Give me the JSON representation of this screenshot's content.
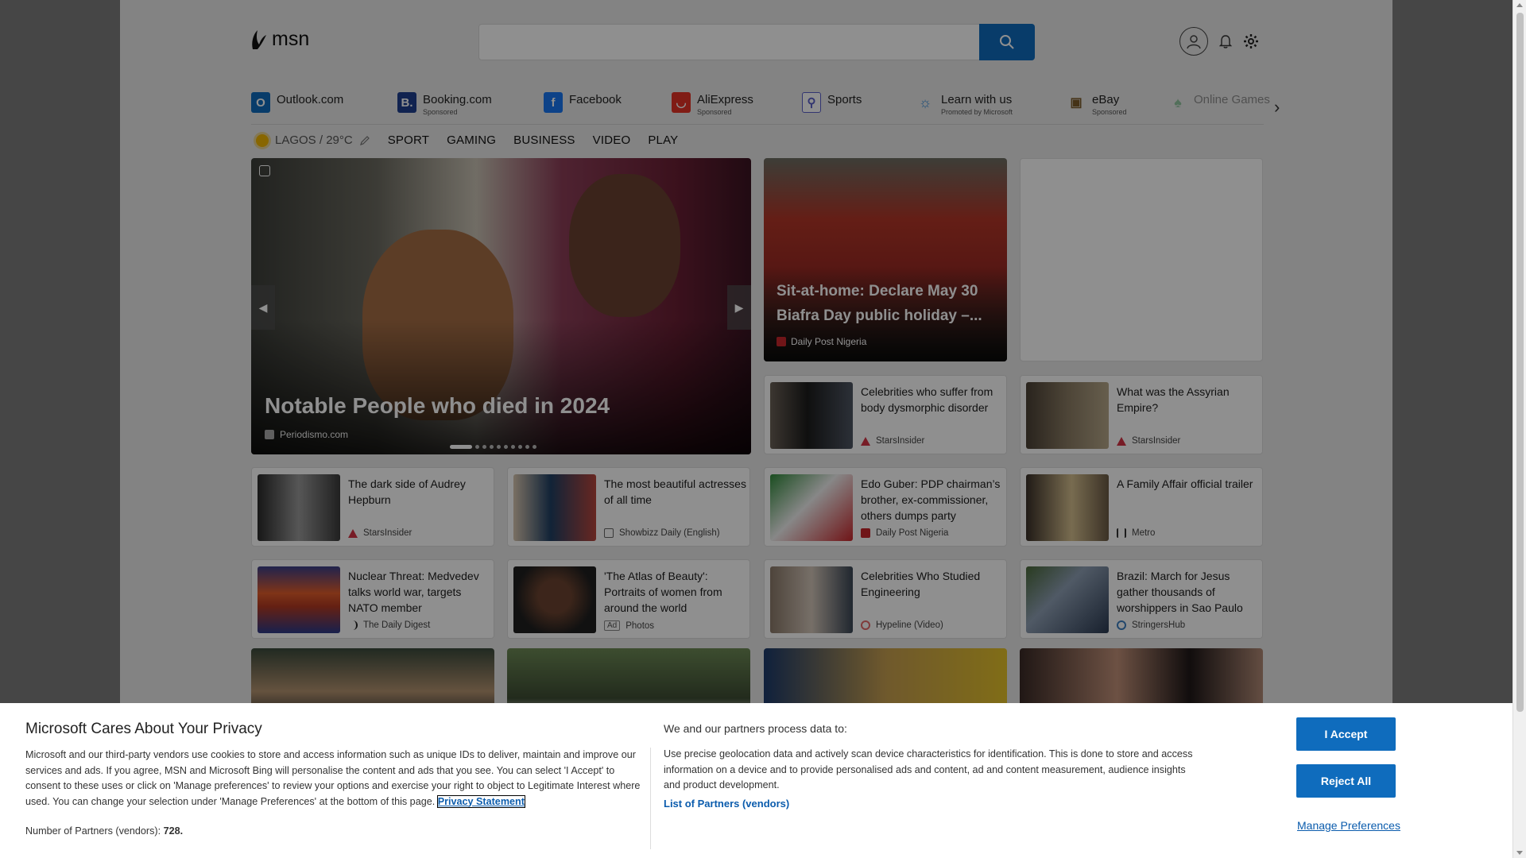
{
  "header": {
    "logo_text": "msn"
  },
  "search": {
    "placeholder": "",
    "value": ""
  },
  "shortcuts": [
    {
      "label": "Outlook.com",
      "sub": "",
      "icon": "outlook-icon",
      "color": "#0f6cbd"
    },
    {
      "label": "Booking.com",
      "sub": "Sponsored",
      "icon": "booking-icon",
      "color": "#1f3f8f"
    },
    {
      "label": "Facebook",
      "sub": "",
      "icon": "facebook-icon",
      "color": "#1877f2"
    },
    {
      "label": "AliExpress",
      "sub": "Sponsored",
      "icon": "aliexpress-icon",
      "color": "#e43226"
    },
    {
      "label": "Sports",
      "sub": "",
      "icon": "sports-icon",
      "color": "#5a5fc8"
    },
    {
      "label": "Learn with us",
      "sub": "Promoted by Microsoft",
      "icon": "lightbulb-icon",
      "color": "#3b8fd9"
    },
    {
      "label": "eBay",
      "sub": "Sponsored",
      "icon": "ebay-icon",
      "color": "#7b5b2a"
    },
    {
      "label": "Online Games",
      "sub": "",
      "icon": "games-icon",
      "color": "#2c9c4a"
    }
  ],
  "nav": {
    "weather": "LAGOS / 29°C",
    "categories": [
      "SPORT",
      "GAMING",
      "BUSINESS",
      "VIDEO",
      "PLAY"
    ]
  },
  "hero": {
    "title": "Notable People who died in 2024",
    "source": "Periodismo.com",
    "slides_total": 10,
    "slide_active": 1
  },
  "feature": {
    "title": "Sit-at-home: Declare May 30 Biafra Day public holiday –...",
    "source": "Daily Post Nigeria"
  },
  "cards": [
    {
      "title": "Celebrities who suffer from body dysmorphic disorder",
      "source": "StarsInsider"
    },
    {
      "title": "What was the Assyrian Empire?",
      "source": "StarsInsider"
    },
    {
      "title": "The dark side of Audrey Hepburn",
      "source": "StarsInsider"
    },
    {
      "title": "The most beautiful actresses of all time",
      "source": "Showbizz Daily (English)"
    },
    {
      "title": "Edo Guber: PDP chairman’s brother, ex-commissioner, others dumps party",
      "source": "Daily Post Nigeria"
    },
    {
      "title": "A Family Affair official trailer",
      "source": "Metro"
    },
    {
      "title": "Nuclear Threat: Medvedev talks world war, targets NATO member",
      "source": "The Daily Digest"
    },
    {
      "title": "'The Atlas of Beauty': Portraits of women from around the world",
      "source": "Photos",
      "ad": "Ad"
    },
    {
      "title": "Celebrities Who Studied Engineering",
      "source": "Hypeline (Video)"
    },
    {
      "title": "Brazil: March for Jesus gather thousands of worshippers in Sao Paulo",
      "source": "StringersHub"
    }
  ],
  "privacy": {
    "title": "Microsoft Cares About Your Privacy",
    "body": "Microsoft and our third-party vendors use cookies to store and access information such as unique IDs to deliver, maintain and improve our services and ads. If you agree, MSN and Microsoft Bing will personalise the content and ads that you see. You can select 'I Accept' to consent to these uses or click on 'Manage preferences' to review your options and exercise your right to object to Legitimate Interest where used.  You can change your selection under 'Manage Preferences' at the bottom of this page.",
    "link": "Privacy Statement",
    "partners_count_label": "Number of Partners (vendors): ",
    "partners_count": "728.",
    "subtitle": "We and our partners process data to:",
    "body2": "Use precise geolocation data and actively scan device characteristics for identification. This is done to store and access information on a device and to provide personalised ads and content, ad and content measurement, audience insights and product development.",
    "partners_link": "List of Partners (vendors)",
    "accept": "I Accept",
    "reject": "Reject All",
    "manage": "Manage Preferences"
  }
}
